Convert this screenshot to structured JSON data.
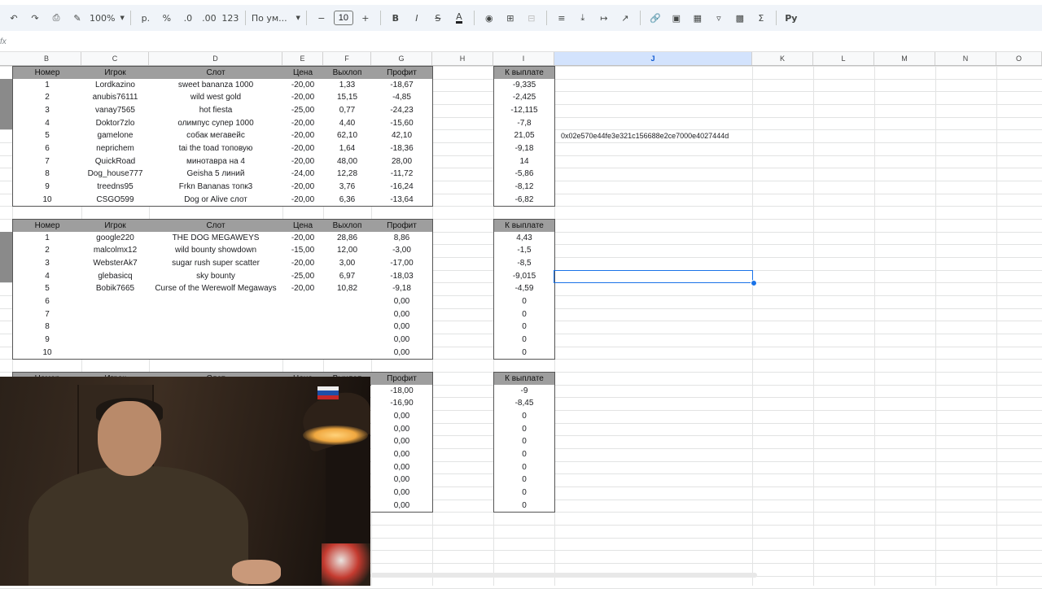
{
  "toolbar": {
    "zoom": "100%",
    "currency": "р.",
    "percent": "%",
    "decrease_decimals": ".0",
    "increase_decimals": ".00",
    "number_format": "123",
    "font_family": "По ум...",
    "font_size": "10",
    "bold": "B",
    "italic": "I",
    "strikethrough": "S",
    "text_color": "A",
    "sum": "Σ",
    "input_tools": "Ру"
  },
  "formula_bar": {
    "fx": "fx",
    "value": ""
  },
  "columns": [
    "B",
    "C",
    "D",
    "E",
    "F",
    "G",
    "H",
    "I",
    "J",
    "K",
    "L",
    "M",
    "N",
    "O"
  ],
  "selected_column": "J",
  "table1": {
    "headers": [
      "Номер",
      "Игрок",
      "Слот",
      "Цена",
      "Выхлоп",
      "Профит"
    ],
    "payout_header": "К выплате",
    "rows": [
      [
        "1",
        "Lordkazino",
        "sweet bananza 1000",
        "-20,00",
        "1,33",
        "-18,67"
      ],
      [
        "2",
        "anubis76111",
        "wild west gold",
        "-20,00",
        "15,15",
        "-4,85"
      ],
      [
        "3",
        "vanay7565",
        "hot fiesta",
        "-25,00",
        "0,77",
        "-24,23"
      ],
      [
        "4",
        "Doktor7zlo",
        "олимпус супер 1000",
        "-20,00",
        "4,40",
        "-15,60"
      ],
      [
        "5",
        "gamelone",
        "собак мегавейс",
        "-20,00",
        "62,10",
        "42,10"
      ],
      [
        "6",
        "neprichem",
        "tai the toad топовую",
        "-20,00",
        "1,64",
        "-18,36"
      ],
      [
        "7",
        "QuickRoad",
        "минотавра на 4",
        "-20,00",
        "48,00",
        "28,00"
      ],
      [
        "8",
        "Dog_house777",
        "Geisha 5 линий",
        "-24,00",
        "12,28",
        "-11,72"
      ],
      [
        "9",
        "treedns95",
        "Frkn Bananas топк3",
        "-20,00",
        "3,76",
        "-16,24"
      ],
      [
        "10",
        "CSGO599",
        "Dog or Alive слот",
        "-20,00",
        "6,36",
        "-13,64"
      ]
    ],
    "payouts": [
      "-9,335",
      "-2,425",
      "-12,115",
      "-7,8",
      "21,05",
      "-9,18",
      "14",
      "-5,86",
      "-8,12",
      "-6,82"
    ],
    "wallet": "0x02e570e44fe3e321c156688e2ce7000e4027444d"
  },
  "table2": {
    "headers": [
      "Номер",
      "Игрок",
      "Слот",
      "Цена",
      "Выхлоп",
      "Профит"
    ],
    "payout_header": "К выплате",
    "rows": [
      [
        "1",
        "google220",
        "THE DOG MEGAWEYS",
        "-20,00",
        "28,86",
        "8,86"
      ],
      [
        "2",
        "malcolmx12",
        "wild bounty showdown",
        "-15,00",
        "12,00",
        "-3,00"
      ],
      [
        "3",
        "WebsterAk7",
        "sugar rush super scatter",
        "-20,00",
        "3,00",
        "-17,00"
      ],
      [
        "4",
        "glebasicq",
        "sky bounty",
        "-25,00",
        "6,97",
        "-18,03"
      ],
      [
        "5",
        "Bobik7665",
        "Curse of the Werewolf Megaways",
        "-20,00",
        "10,82",
        "-9,18"
      ],
      [
        "6",
        "",
        "",
        "",
        "",
        "0,00"
      ],
      [
        "7",
        "",
        "",
        "",
        "",
        "0,00"
      ],
      [
        "8",
        "",
        "",
        "",
        "",
        "0,00"
      ],
      [
        "9",
        "",
        "",
        "",
        "",
        "0,00"
      ],
      [
        "10",
        "",
        "",
        "",
        "",
        "0,00"
      ]
    ],
    "payouts": [
      "4,43",
      "-1,5",
      "-8,5",
      "-9,015",
      "-4,59",
      "0",
      "0",
      "0",
      "0",
      "0"
    ]
  },
  "table3": {
    "partial_headers": [
      "Номер",
      "Игрок",
      "Слот",
      "Цена",
      "Выхлоп"
    ],
    "profit_header": "Профит",
    "payout_header": "К выплате",
    "profits": [
      "-18,00",
      "-16,90",
      "0,00",
      "0,00",
      "0,00",
      "0,00",
      "0,00",
      "0,00",
      "0,00",
      "0,00"
    ],
    "payouts": [
      "-9",
      "-8,45",
      "0",
      "0",
      "0",
      "0",
      "0",
      "0",
      "0",
      "0"
    ]
  },
  "accent_color": "#1a73e8",
  "header_color": "#9e9e9e"
}
